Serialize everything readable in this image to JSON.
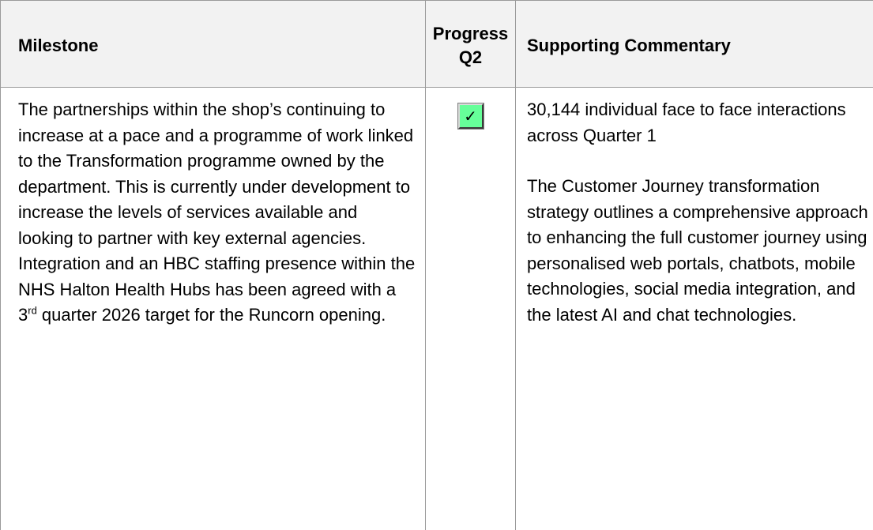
{
  "table": {
    "headers": {
      "milestone": "Milestone",
      "progress_line1": "Progress",
      "progress_line2": "Q2",
      "commentary": "Supporting Commentary"
    },
    "row": {
      "milestone_before_sup": "The partnerships within the shop’s continuing to increase at a pace and a programme of work linked to the Transformation programme owned by the department. This is currently under development to increase the levels of services available and looking to partner with key external agencies. Integration and an HBC staffing presence within the NHS Halton Health Hubs has been agreed with a 3",
      "milestone_sup": "rd",
      "milestone_after_sup": " quarter 2026 target for the Runcorn opening.",
      "progress_symbol": "✓",
      "progress_symbol_icon": "checkmark-icon",
      "commentary_paragraphs": [
        "30,144 individual face to face interactions across Quarter 1",
        "The Customer Journey transformation strategy outlines a comprehensive approach to enhancing the full customer journey using personalised web portals, chatbots, mobile technologies, social media integration, and the latest AI and chat technologies."
      ]
    }
  },
  "colors": {
    "header_bg": "#f2f2f2",
    "border": "#9a9a9a",
    "check_green": "#66ff99",
    "text": "#000000"
  }
}
